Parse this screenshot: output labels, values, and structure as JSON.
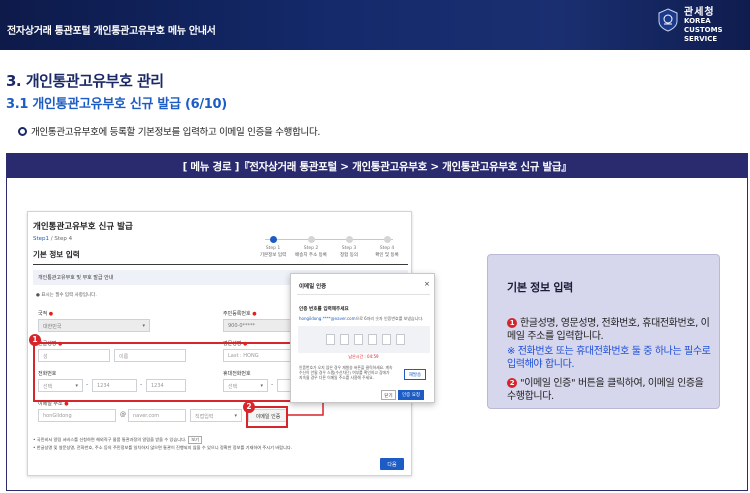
{
  "header": {
    "title": "전자상거래 통관포털 개인통관고유부호 메뉴 안내서",
    "agency_ko": "관세청",
    "agency_en_1": "KOREA CUSTOMS",
    "agency_en_2": "SERVICE"
  },
  "section": {
    "h1": "3. 개인통관고유부호 관리",
    "h2": "3.1 개인통관고유부호 신규 발급 (6/10)",
    "description": "개인통관고유부호에 등록할 기본정보를 입력하고 이메일 인증을 수행합니다."
  },
  "menu_path": "[ 메뉴 경로 ]『전자상거래 통관포털 > 개인통관고유부호 > 개인통관고유부호 신규 발급』",
  "screenshot": {
    "title": "개인통관고유부호 신규 발급",
    "step_current": "Step1",
    "step_total": "/ Step 4",
    "subtitle": "기본 정보 입력",
    "steps": [
      {
        "num": "Step 1",
        "label": "기본정보 입력"
      },
      {
        "num": "Step 2",
        "label": "배송지 주소 등록"
      },
      {
        "num": "Step 3",
        "label": "정합 동의"
      },
      {
        "num": "Step 4",
        "label": "확인 및 등록"
      }
    ],
    "section_title": "개인통관고유부호 및 부호 발급 안내",
    "required_note": "● 표시는 필수 입력 사항입니다.",
    "fields": {
      "nationality_label": "국적",
      "nationality_value": "대한민국",
      "resident_label": "주민등록번호",
      "resident_value": "900-0*****",
      "korean_name_label": "한글성명",
      "korean_name_first": "성",
      "korean_name_last": "이름",
      "english_name_label": "영문성명",
      "english_name_placeholder": "Last : HONG",
      "phone_label": "전화번호",
      "mobile_label": "휴대전화번호",
      "select_label": "선택",
      "phone_mid": "1234",
      "phone_last": "1234",
      "email_label": "이메일 주소",
      "email_id": "honGildong",
      "email_at": "@",
      "email_domain": "naver.com",
      "email_direct": "직접입력",
      "email_verify": "이메일 인증",
      "dash": "-"
    },
    "notes": [
      "• 국민비서 알림 서비스를 신청하면 해외직구 물품 통관과정의 알림을 받을 수 있습니다.",
      "• 한글성명 및 영문성명, 전화번호, 주소 등의 주민정보를 일치하지 않으면 통관이 진행되지 않을 수 있으니 정확한 정보를 기재하여 주시기 바랍니다."
    ],
    "notes_button": "보기",
    "next_button": "다음"
  },
  "modal": {
    "title": "이메일 인증",
    "close": "×",
    "heading": "인증 번호를 입력해주세요",
    "sub_email": "hongildong.****@naver.com",
    "sub_text": "으로 6자리 숫자 인증번호를 보냈습니다.",
    "timer": "남은시간 : 04:59",
    "info": "인증번호가 오지 않은 경우 재발송 버튼을 클릭하세요. 계속 수신이 안될 경우 스팸(수신차단) 여부를 확인하고 장애가 지속될 경우 다른 이메일 주소를 사용해 주세요.",
    "resend": "재발송",
    "cancel": "닫기",
    "confirm": "인증 요청"
  },
  "badges": {
    "one": "1",
    "two": "2"
  },
  "side_box": {
    "title": "기본 정보 입력",
    "item1_num": "1",
    "item1_text": "한글성명, 영문성명, 전화번호, 휴대전화번호, 이메일 주소를 입력합니다.",
    "item1_note": "※ 전화번호 또는 휴대전화번호 둘 중 하나는 필수로 입력해야 합니다.",
    "item2_num": "2",
    "item2_text": "\"이메일 인증\" 버튼을 클릭하여, 이메일 인증을 수행합니다."
  },
  "colors": {
    "header_bg": "#142a6b",
    "title_navy": "#1b2a66",
    "subtitle_blue": "#1d5cc4",
    "path_bar": "#2a2a6e",
    "highlight_red": "#d7262b",
    "side_bg": "#d6d6ec"
  }
}
